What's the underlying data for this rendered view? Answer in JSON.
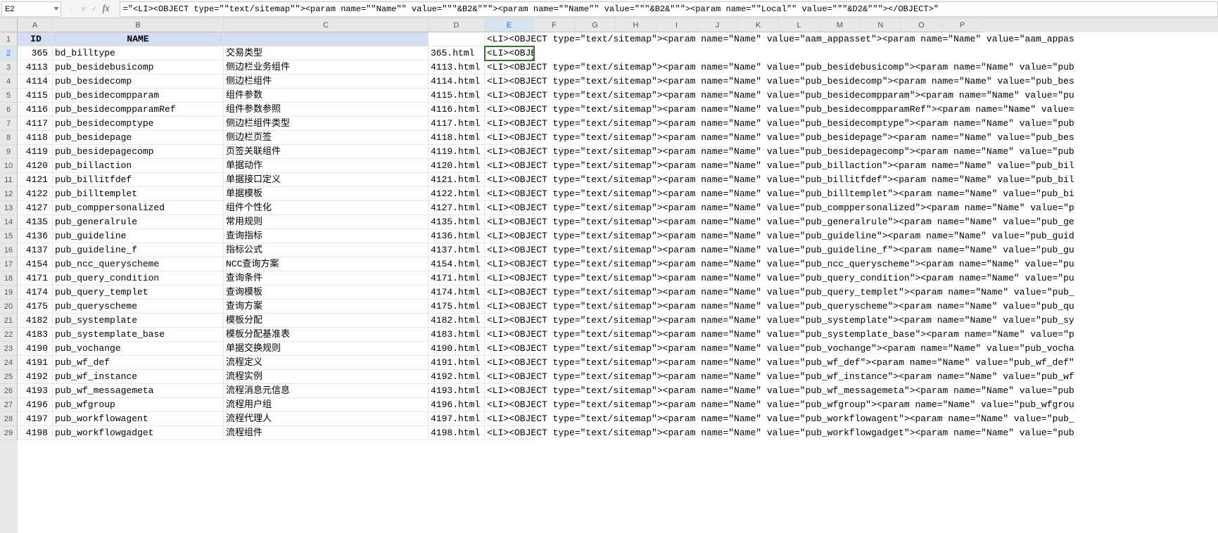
{
  "name_box": "E2",
  "formula": "=\"<LI><OBJECT type=\"\"text/sitemap\"\"><param name=\"\"Name\"\" value=\"\"\"&B2&\"\"\"><param name=\"\"Name\"\" value=\"\"\"&B2&\"\"\"><param name=\"\"Local\"\" value=\"\"\"&D2&\"\"\"></OBJECT>\"",
  "columns": [
    "A",
    "B",
    "C",
    "D",
    "E",
    "F",
    "G",
    "H",
    "I",
    "J",
    "K",
    "L",
    "M",
    "N",
    "O",
    "P"
  ],
  "col_widths": {
    "A": 50,
    "B": 243,
    "C": 291,
    "D": 80,
    "E": 70,
    "F": 58,
    "G": 58,
    "H": 58,
    "I": 58,
    "J": 58,
    "K": 58,
    "L": 58,
    "M": 58,
    "N": 58,
    "O": 58,
    "P": 58
  },
  "header_row": {
    "A": "ID",
    "B": "NAME",
    "C": "",
    "D": "",
    "E_overflow": "<LI><OBJECT type=\"text/sitemap\"><param name=\"Name\" value=\"aam_appasset\"><param name=\"Name\" value=\"aam_appas"
  },
  "rows": [
    {
      "n": 2,
      "A": "365",
      "B": "bd_billtype",
      "C": "交易类型",
      "D": "365.html",
      "E": "<LI><OBJECT type=\"text/sitemap\"><param name=\"Name\" value=\"bd_billtype\"><param name=\"Name\" value=\"bd_billtyp"
    },
    {
      "n": 3,
      "A": "4113",
      "B": "pub_besidebusicomp",
      "C": "侧边栏业务组件",
      "D": "4113.html",
      "E": "<LI><OBJECT type=\"text/sitemap\"><param name=\"Name\" value=\"pub_besidebusicomp\"><param name=\"Name\" value=\"pub"
    },
    {
      "n": 4,
      "A": "4114",
      "B": "pub_besidecomp",
      "C": "侧边栏组件",
      "D": "4114.html",
      "E": "<LI><OBJECT type=\"text/sitemap\"><param name=\"Name\" value=\"pub_besidecomp\"><param name=\"Name\" value=\"pub_bes"
    },
    {
      "n": 5,
      "A": "4115",
      "B": "pub_besidecompparam",
      "C": "组件参数",
      "D": "4115.html",
      "E": "<LI><OBJECT type=\"text/sitemap\"><param name=\"Name\" value=\"pub_besidecompparam\"><param name=\"Name\" value=\"pu"
    },
    {
      "n": 6,
      "A": "4116",
      "B": "pub_besidecompparamRef",
      "C": "组件参数参照",
      "D": "4116.html",
      "E": "<LI><OBJECT type=\"text/sitemap\"><param name=\"Name\" value=\"pub_besidecompparamRef\"><param name=\"Name\" value="
    },
    {
      "n": 7,
      "A": "4117",
      "B": "pub_besidecomptype",
      "C": "侧边栏组件类型",
      "D": "4117.html",
      "E": "<LI><OBJECT type=\"text/sitemap\"><param name=\"Name\" value=\"pub_besidecomptype\"><param name=\"Name\" value=\"pub"
    },
    {
      "n": 8,
      "A": "4118",
      "B": "pub_besidepage",
      "C": "侧边栏页签",
      "D": "4118.html",
      "E": "<LI><OBJECT type=\"text/sitemap\"><param name=\"Name\" value=\"pub_besidepage\"><param name=\"Name\" value=\"pub_bes"
    },
    {
      "n": 9,
      "A": "4119",
      "B": "pub_besidepagecomp",
      "C": "页签关联组件",
      "D": "4119.html",
      "E": "<LI><OBJECT type=\"text/sitemap\"><param name=\"Name\" value=\"pub_besidepagecomp\"><param name=\"Name\" value=\"pub"
    },
    {
      "n": 10,
      "A": "4120",
      "B": "pub_billaction",
      "C": "单据动作",
      "D": "4120.html",
      "E": "<LI><OBJECT type=\"text/sitemap\"><param name=\"Name\" value=\"pub_billaction\"><param name=\"Name\" value=\"pub_bil"
    },
    {
      "n": 11,
      "A": "4121",
      "B": "pub_billitfdef",
      "C": "单据接口定义",
      "D": "4121.html",
      "E": "<LI><OBJECT type=\"text/sitemap\"><param name=\"Name\" value=\"pub_billitfdef\"><param name=\"Name\" value=\"pub_bil"
    },
    {
      "n": 12,
      "A": "4122",
      "B": "pub_billtemplet",
      "C": "单据模板",
      "D": "4122.html",
      "E": "<LI><OBJECT type=\"text/sitemap\"><param name=\"Name\" value=\"pub_billtemplet\"><param name=\"Name\" value=\"pub_bi"
    },
    {
      "n": 13,
      "A": "4127",
      "B": "pub_comppersonalized",
      "C": "组件个性化",
      "D": "4127.html",
      "E": "<LI><OBJECT type=\"text/sitemap\"><param name=\"Name\" value=\"pub_comppersonalized\"><param name=\"Name\" value=\"p"
    },
    {
      "n": 14,
      "A": "4135",
      "B": "pub_generalrule",
      "C": "常用规则",
      "D": "4135.html",
      "E": "<LI><OBJECT type=\"text/sitemap\"><param name=\"Name\" value=\"pub_generalrule\"><param name=\"Name\" value=\"pub_ge"
    },
    {
      "n": 15,
      "A": "4136",
      "B": "pub_guideline",
      "C": "查询指标",
      "D": "4136.html",
      "E": "<LI><OBJECT type=\"text/sitemap\"><param name=\"Name\" value=\"pub_guideline\"><param name=\"Name\" value=\"pub_guid"
    },
    {
      "n": 16,
      "A": "4137",
      "B": "pub_guideline_f",
      "C": "指标公式",
      "D": "4137.html",
      "E": "<LI><OBJECT type=\"text/sitemap\"><param name=\"Name\" value=\"pub_guideline_f\"><param name=\"Name\" value=\"pub_gu"
    },
    {
      "n": 17,
      "A": "4154",
      "B": "pub_ncc_queryscheme",
      "C": "NCC查询方案",
      "D": "4154.html",
      "E": "<LI><OBJECT type=\"text/sitemap\"><param name=\"Name\" value=\"pub_ncc_queryscheme\"><param name=\"Name\" value=\"pu"
    },
    {
      "n": 18,
      "A": "4171",
      "B": "pub_query_condition",
      "C": "查询条件",
      "D": "4171.html",
      "E": "<LI><OBJECT type=\"text/sitemap\"><param name=\"Name\" value=\"pub_query_condition\"><param name=\"Name\" value=\"pu"
    },
    {
      "n": 19,
      "A": "4174",
      "B": "pub_query_templet",
      "C": "查询模板",
      "D": "4174.html",
      "E": "<LI><OBJECT type=\"text/sitemap\"><param name=\"Name\" value=\"pub_query_templet\"><param name=\"Name\" value=\"pub_"
    },
    {
      "n": 20,
      "A": "4175",
      "B": "pub_queryscheme",
      "C": "查询方案",
      "D": "4175.html",
      "E": "<LI><OBJECT type=\"text/sitemap\"><param name=\"Name\" value=\"pub_queryscheme\"><param name=\"Name\" value=\"pub_qu"
    },
    {
      "n": 21,
      "A": "4182",
      "B": "pub_systemplate",
      "C": "模板分配",
      "D": "4182.html",
      "E": "<LI><OBJECT type=\"text/sitemap\"><param name=\"Name\" value=\"pub_systemplate\"><param name=\"Name\" value=\"pub_sy"
    },
    {
      "n": 22,
      "A": "4183",
      "B": "pub_systemplate_base",
      "C": "模板分配基准表",
      "D": "4183.html",
      "E": "<LI><OBJECT type=\"text/sitemap\"><param name=\"Name\" value=\"pub_systemplate_base\"><param name=\"Name\" value=\"p"
    },
    {
      "n": 23,
      "A": "4190",
      "B": "pub_vochange",
      "C": "单据交换规则",
      "D": "4190.html",
      "E": "<LI><OBJECT type=\"text/sitemap\"><param name=\"Name\" value=\"pub_vochange\"><param name=\"Name\" value=\"pub_vocha"
    },
    {
      "n": 24,
      "A": "4191",
      "B": "pub_wf_def",
      "C": "流程定义",
      "D": "4191.html",
      "E": "<LI><OBJECT type=\"text/sitemap\"><param name=\"Name\" value=\"pub_wf_def\"><param name=\"Name\" value=\"pub_wf_def\""
    },
    {
      "n": 25,
      "A": "4192",
      "B": "pub_wf_instance",
      "C": "流程实例",
      "D": "4192.html",
      "E": "<LI><OBJECT type=\"text/sitemap\"><param name=\"Name\" value=\"pub_wf_instance\"><param name=\"Name\" value=\"pub_wf"
    },
    {
      "n": 26,
      "A": "4193",
      "B": "pub_wf_messagemeta",
      "C": "流程消息元信息",
      "D": "4193.html",
      "E": "<LI><OBJECT type=\"text/sitemap\"><param name=\"Name\" value=\"pub_wf_messagemeta\"><param name=\"Name\" value=\"pub"
    },
    {
      "n": 27,
      "A": "4196",
      "B": "pub_wfgroup",
      "C": "流程用户组",
      "D": "4196.html",
      "E": "<LI><OBJECT type=\"text/sitemap\"><param name=\"Name\" value=\"pub_wfgroup\"><param name=\"Name\" value=\"pub_wfgrou"
    },
    {
      "n": 28,
      "A": "4197",
      "B": "pub_workflowagent",
      "C": "流程代理人",
      "D": "4197.html",
      "E": "<LI><OBJECT type=\"text/sitemap\"><param name=\"Name\" value=\"pub_workflowagent\"><param name=\"Name\" value=\"pub_"
    },
    {
      "n": 29,
      "A": "4198",
      "B": "pub_workflowgadget",
      "C": "流程组件",
      "D": "4198.html",
      "E": "<LI><OBJECT type=\"text/sitemap\"><param name=\"Name\" value=\"pub_workflowgadget\"><param name=\"Name\" value=\"pub"
    }
  ],
  "active_cell": "E2",
  "active_cell_display": "<LI><OBJE"
}
